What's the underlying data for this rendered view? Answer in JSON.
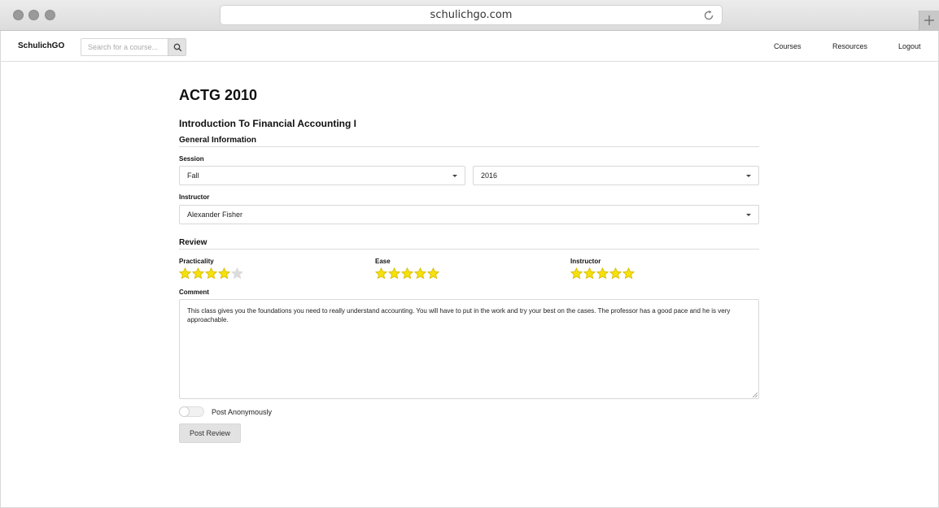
{
  "browser": {
    "url": "schulichgo.com"
  },
  "navbar": {
    "brand": "SchulichGO",
    "search_placeholder": "Search for a course...",
    "links": {
      "courses": "Courses",
      "resources": "Resources",
      "logout": "Logout"
    }
  },
  "course": {
    "code": "ACTG 2010",
    "name": "Introduction To Financial Accounting I"
  },
  "general": {
    "heading": "General Information",
    "session_label": "Session",
    "term_value": "Fall",
    "year_value": "2016",
    "instructor_label": "Instructor",
    "instructor_value": "Alexander Fisher"
  },
  "review": {
    "heading": "Review",
    "ratings": [
      {
        "label": "Practicality",
        "value": 4,
        "max": 5
      },
      {
        "label": "Ease",
        "value": 5,
        "max": 5
      },
      {
        "label": "Instructor",
        "value": 5,
        "max": 5
      }
    ],
    "comment_label": "Comment",
    "comment_text": "This class gives you the foundations you need to really understand accounting. You will have to put in the work and try your best on the cases. The professor has a good pace and he is very approachable.",
    "anonymous_label": "Post Anonymously",
    "anonymous": false,
    "submit_label": "Post Review"
  },
  "colors": {
    "star_filled": "#f5e10c",
    "star_outline": "#d8b800",
    "star_empty": "#dcdcdc"
  }
}
